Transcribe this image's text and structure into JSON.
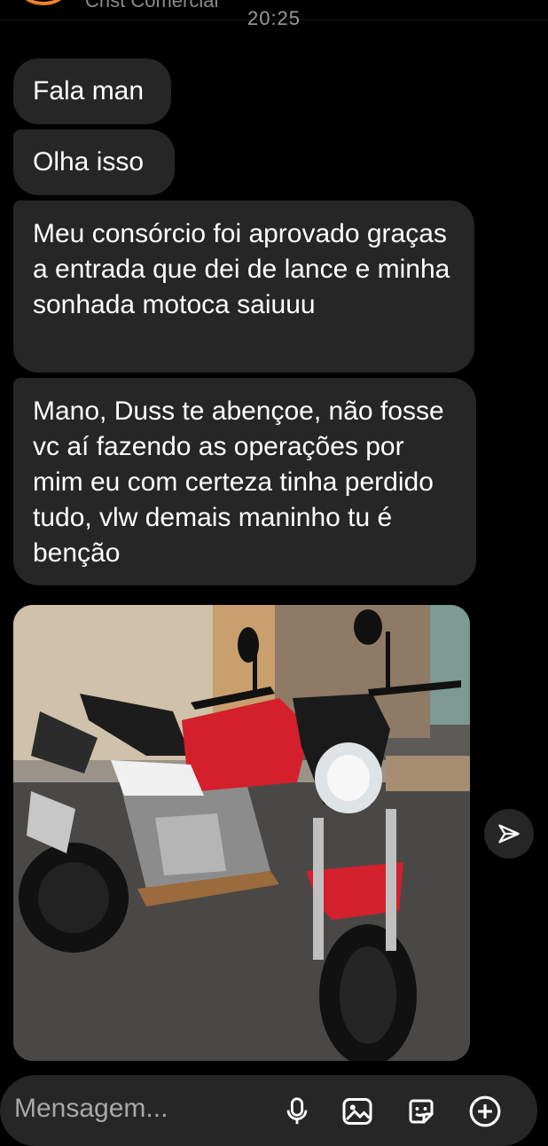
{
  "header": {
    "contact_name": "Crist Comercial",
    "timestamp": "20:25"
  },
  "messages": [
    {
      "text": "Fala man"
    },
    {
      "text": "Olha isso"
    },
    {
      "text": "Meu consórcio foi aprovado graças a entrada que dei de lance e minha sonhada motoca saiuuu"
    },
    {
      "text": "Mano, Duss te abençoe, não fosse vc aí fazendo as operações por mim eu com certeza tinha perdido tudo, vlw demais maninho tu é benção"
    }
  ],
  "photo": {
    "description_icon": "motorcycle-photo"
  },
  "composer": {
    "placeholder": "Mensagem...",
    "icons": [
      "microphone-icon",
      "gallery-icon",
      "sticker-icon",
      "plus-icon"
    ]
  },
  "share_icon": "send-icon",
  "colors": {
    "background": "#000000",
    "bubble": "#262626",
    "muted_text": "#a8a8a8",
    "avatar_ring": "#f0822a"
  }
}
